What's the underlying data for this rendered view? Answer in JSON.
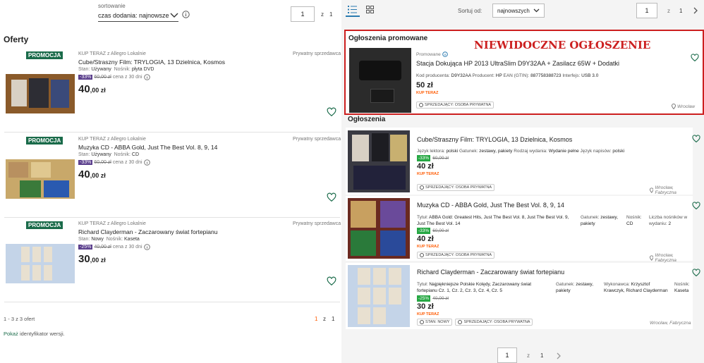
{
  "left": {
    "sort_label": "sortowanie",
    "sort_value": "czas dodania: najnowsze",
    "page_current": "1",
    "page_sep": "z",
    "page_total": "1",
    "heading": "Oferty",
    "offers": [
      {
        "badge": "PROMOCJA",
        "source": "KUP TERAZ z Allegro Lokalnie",
        "seller": "Prywatny sprzedawca",
        "title": "Cube/Straszny Film: TRYLOGIA, 13 Dzielnica, Kosmos",
        "cond_label": "Stan:",
        "cond": "Używany",
        "medium_label": "Nośnik:",
        "medium": "płyta DVD",
        "discount": "-33%",
        "old_price": "60,00 zł",
        "old_suffix": "cena z 30 dni",
        "price_int": "40",
        "price_dec": ",00 zł"
      },
      {
        "badge": "PROMOCJA",
        "source": "KUP TERAZ z Allegro Lokalnie",
        "seller": "Prywatny sprzedawca",
        "title": "Muzyka CD - ABBA Gold, Just The Best Vol. 8, 9, 14",
        "cond_label": "Stan:",
        "cond": "Używany",
        "medium_label": "Nośnik:",
        "medium": "CD",
        "discount": "-33%",
        "old_price": "60,00 zł",
        "old_suffix": "cena z 30 dni",
        "price_int": "40",
        "price_dec": ",00 zł"
      },
      {
        "badge": "PROMOCJA",
        "source": "KUP TERAZ z Allegro Lokalnie",
        "seller": "Prywatny sprzedawca",
        "title": "Richard Clayderman - Zaczarowany świat fortepianu",
        "cond_label": "Stan:",
        "cond": "Nowy",
        "medium_label": "Nośnik:",
        "medium": "Kaseta",
        "discount": "-25%",
        "old_price": "40,00 zł",
        "old_suffix": "cena z 30 dni",
        "price_int": "30",
        "price_dec": ",00 zł"
      }
    ],
    "footer_count": "1 - 3 z 3 ofert",
    "footer_page": "1",
    "footer_sep": "z",
    "footer_total": "1",
    "version_link": "Pokaż",
    "version_text": "identyfikator wersji."
  },
  "right": {
    "sort_label": "Sortuj od:",
    "sort_value": "najnowszych",
    "page_current": "1",
    "page_sep": "z",
    "page_total": "1",
    "promo_heading": "Ogłoszenia promowane",
    "overlay_text": "NIEWIDOCZNE OGŁOSZENIE",
    "promo": {
      "label": "Promowane",
      "title": "Stacja Dokująca HP 2013 UltraSlim D9Y32AA + Zasilacz 65W + Dodatki",
      "specs": [
        [
          "Kod producenta:",
          "D9Y32AA"
        ],
        [
          "Producent:",
          "HP"
        ],
        [
          "EAN (GTIN):",
          "887758388723"
        ],
        [
          "Interfejs:",
          "USB 3.0"
        ]
      ],
      "price": "50 zł",
      "kup": "KUP TERAZ",
      "tag": "SPRZEDAJĄCY: OSOBA PRYWATNA",
      "location": "Wrocław"
    },
    "ads_heading": "Ogłoszenia",
    "ads": [
      {
        "title": "Cube/Straszny Film: TRYLOGIA, 13 Dzielnica, Kosmos",
        "specs": [
          [
            "Język lektora:",
            "polski"
          ],
          [
            "Gatunek:",
            "zestawy, pakiety"
          ],
          [
            "Rodzaj wydania:",
            "Wydanie pełne"
          ],
          [
            "Język napisów:",
            "polski"
          ]
        ],
        "discount": "-33%",
        "old": "60,00 zł",
        "price": "40 zł",
        "kup": "KUP TERAZ",
        "tags": [
          "SPRZEDAJĄCY: OSOBA PRYWATNA"
        ],
        "location": "Wrocław, Fabryczna"
      },
      {
        "title": "Muzyka CD - ABBA Gold, Just The Best Vol. 8, 9, 14",
        "specs": [
          [
            "Tytuł:",
            "ABBA Gold: Greatest Hits, Just The Best Vol. 8, Just The Best Vol. 9, Just The Best Vol. 14"
          ],
          [
            "Gatunek:",
            "zestawy, pakiety"
          ],
          [
            "Nośnik:",
            "CD"
          ],
          [
            "Liczba nośników w wydaniu:",
            "2"
          ]
        ],
        "discount": "-33%",
        "old": "60,00 zł",
        "price": "40 zł",
        "kup": "KUP TERAZ",
        "tags": [
          "SPRZEDAJĄCY: OSOBA PRYWATNA"
        ],
        "location": "Wrocław, Fabryczna"
      },
      {
        "title": "Richard Clayderman - Zaczarowany świat fortepianu",
        "specs": [
          [
            "Tytuł:",
            "Najpiękniejsze Polskie Kolędy, Zaczarowany świat fortepianu Cz. 1, Cz. 2, Cz. 3, Cz. 4, Cz. 5"
          ],
          [
            "Gatunek:",
            "zestawy, pakiety"
          ],
          [
            "Wykonawca:",
            "Krzysztof Krawczyk, Richard Clayderman"
          ],
          [
            "Nośnik:",
            "Kaseta"
          ]
        ],
        "discount": "-25%",
        "old": "40,00 zł",
        "price": "30 zł",
        "kup": "KUP TERAZ",
        "tags": [
          "STAN: NOWY",
          "SPRZEDAJĄCY: OSOBA PRYWATNA"
        ],
        "location": "Wrocław, Fabryczna"
      }
    ],
    "bottom_page": "1",
    "bottom_sep": "z",
    "bottom_total": "1"
  },
  "colors": {
    "promo_badge": "#1a6b4a",
    "discount_left": "#5a3e8c",
    "discount_right": "#27a844",
    "kup_teraz": "#ff5a00",
    "overlay": "#cc1f1f",
    "heart": "#1a6b4a"
  }
}
